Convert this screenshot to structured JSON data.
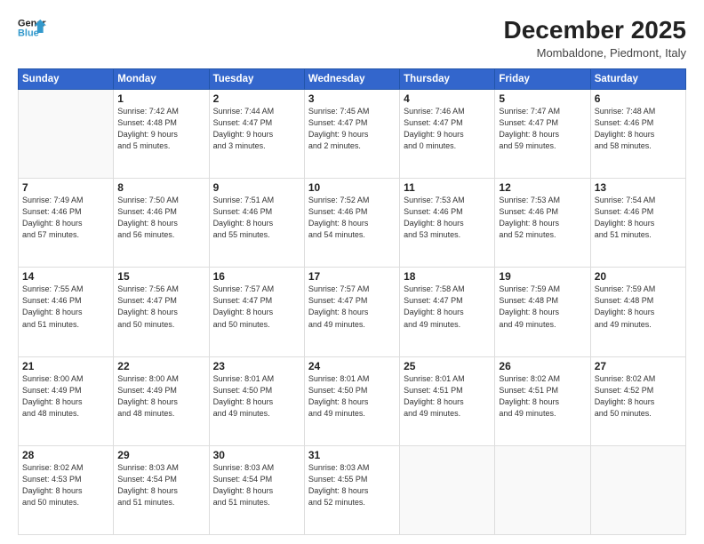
{
  "logo": {
    "line1": "General",
    "line2": "Blue"
  },
  "title": "December 2025",
  "subtitle": "Mombaldone, Piedmont, Italy",
  "days_of_week": [
    "Sunday",
    "Monday",
    "Tuesday",
    "Wednesday",
    "Thursday",
    "Friday",
    "Saturday"
  ],
  "weeks": [
    [
      {
        "day": "",
        "info": ""
      },
      {
        "day": "1",
        "info": "Sunrise: 7:42 AM\nSunset: 4:48 PM\nDaylight: 9 hours\nand 5 minutes."
      },
      {
        "day": "2",
        "info": "Sunrise: 7:44 AM\nSunset: 4:47 PM\nDaylight: 9 hours\nand 3 minutes."
      },
      {
        "day": "3",
        "info": "Sunrise: 7:45 AM\nSunset: 4:47 PM\nDaylight: 9 hours\nand 2 minutes."
      },
      {
        "day": "4",
        "info": "Sunrise: 7:46 AM\nSunset: 4:47 PM\nDaylight: 9 hours\nand 0 minutes."
      },
      {
        "day": "5",
        "info": "Sunrise: 7:47 AM\nSunset: 4:47 PM\nDaylight: 8 hours\nand 59 minutes."
      },
      {
        "day": "6",
        "info": "Sunrise: 7:48 AM\nSunset: 4:46 PM\nDaylight: 8 hours\nand 58 minutes."
      }
    ],
    [
      {
        "day": "7",
        "info": "Sunrise: 7:49 AM\nSunset: 4:46 PM\nDaylight: 8 hours\nand 57 minutes."
      },
      {
        "day": "8",
        "info": "Sunrise: 7:50 AM\nSunset: 4:46 PM\nDaylight: 8 hours\nand 56 minutes."
      },
      {
        "day": "9",
        "info": "Sunrise: 7:51 AM\nSunset: 4:46 PM\nDaylight: 8 hours\nand 55 minutes."
      },
      {
        "day": "10",
        "info": "Sunrise: 7:52 AM\nSunset: 4:46 PM\nDaylight: 8 hours\nand 54 minutes."
      },
      {
        "day": "11",
        "info": "Sunrise: 7:53 AM\nSunset: 4:46 PM\nDaylight: 8 hours\nand 53 minutes."
      },
      {
        "day": "12",
        "info": "Sunrise: 7:53 AM\nSunset: 4:46 PM\nDaylight: 8 hours\nand 52 minutes."
      },
      {
        "day": "13",
        "info": "Sunrise: 7:54 AM\nSunset: 4:46 PM\nDaylight: 8 hours\nand 51 minutes."
      }
    ],
    [
      {
        "day": "14",
        "info": "Sunrise: 7:55 AM\nSunset: 4:46 PM\nDaylight: 8 hours\nand 51 minutes."
      },
      {
        "day": "15",
        "info": "Sunrise: 7:56 AM\nSunset: 4:47 PM\nDaylight: 8 hours\nand 50 minutes."
      },
      {
        "day": "16",
        "info": "Sunrise: 7:57 AM\nSunset: 4:47 PM\nDaylight: 8 hours\nand 50 minutes."
      },
      {
        "day": "17",
        "info": "Sunrise: 7:57 AM\nSunset: 4:47 PM\nDaylight: 8 hours\nand 49 minutes."
      },
      {
        "day": "18",
        "info": "Sunrise: 7:58 AM\nSunset: 4:47 PM\nDaylight: 8 hours\nand 49 minutes."
      },
      {
        "day": "19",
        "info": "Sunrise: 7:59 AM\nSunset: 4:48 PM\nDaylight: 8 hours\nand 49 minutes."
      },
      {
        "day": "20",
        "info": "Sunrise: 7:59 AM\nSunset: 4:48 PM\nDaylight: 8 hours\nand 49 minutes."
      }
    ],
    [
      {
        "day": "21",
        "info": "Sunrise: 8:00 AM\nSunset: 4:49 PM\nDaylight: 8 hours\nand 48 minutes."
      },
      {
        "day": "22",
        "info": "Sunrise: 8:00 AM\nSunset: 4:49 PM\nDaylight: 8 hours\nand 48 minutes."
      },
      {
        "day": "23",
        "info": "Sunrise: 8:01 AM\nSunset: 4:50 PM\nDaylight: 8 hours\nand 49 minutes."
      },
      {
        "day": "24",
        "info": "Sunrise: 8:01 AM\nSunset: 4:50 PM\nDaylight: 8 hours\nand 49 minutes."
      },
      {
        "day": "25",
        "info": "Sunrise: 8:01 AM\nSunset: 4:51 PM\nDaylight: 8 hours\nand 49 minutes."
      },
      {
        "day": "26",
        "info": "Sunrise: 8:02 AM\nSunset: 4:51 PM\nDaylight: 8 hours\nand 49 minutes."
      },
      {
        "day": "27",
        "info": "Sunrise: 8:02 AM\nSunset: 4:52 PM\nDaylight: 8 hours\nand 50 minutes."
      }
    ],
    [
      {
        "day": "28",
        "info": "Sunrise: 8:02 AM\nSunset: 4:53 PM\nDaylight: 8 hours\nand 50 minutes."
      },
      {
        "day": "29",
        "info": "Sunrise: 8:03 AM\nSunset: 4:54 PM\nDaylight: 8 hours\nand 51 minutes."
      },
      {
        "day": "30",
        "info": "Sunrise: 8:03 AM\nSunset: 4:54 PM\nDaylight: 8 hours\nand 51 minutes."
      },
      {
        "day": "31",
        "info": "Sunrise: 8:03 AM\nSunset: 4:55 PM\nDaylight: 8 hours\nand 52 minutes."
      },
      {
        "day": "",
        "info": ""
      },
      {
        "day": "",
        "info": ""
      },
      {
        "day": "",
        "info": ""
      }
    ]
  ]
}
